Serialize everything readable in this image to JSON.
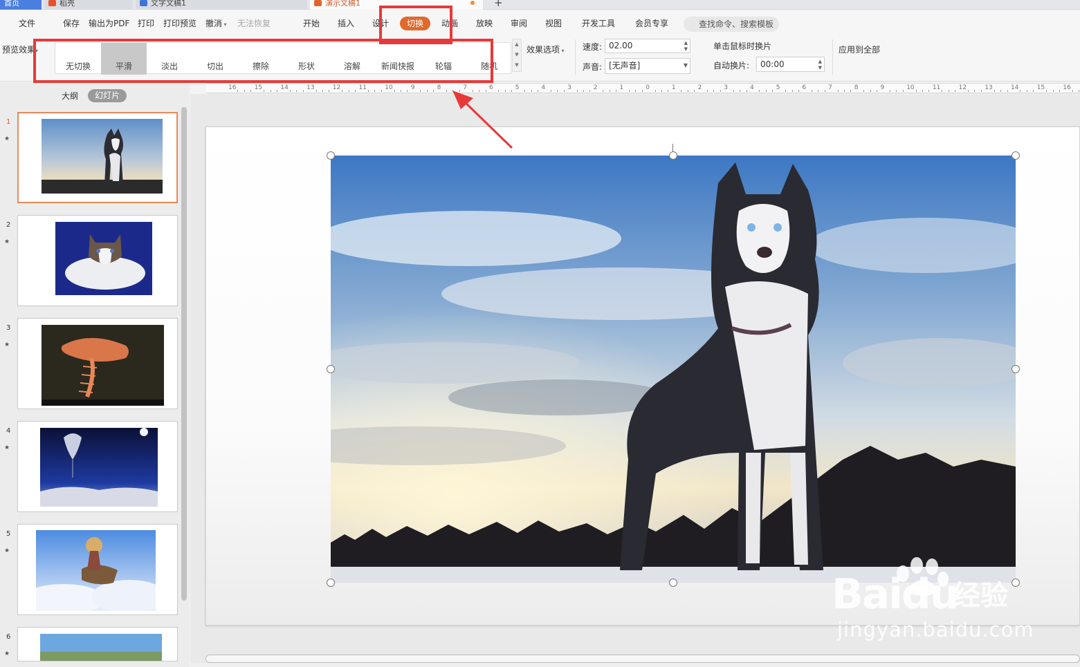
{
  "tabs": {
    "home": "首页",
    "daoke": "稻壳",
    "doc": "文字文稿1",
    "ppt": "演示文稿1",
    "add": "+"
  },
  "menu": {
    "file": "文件",
    "save": "保存",
    "export_pdf": "输出为PDF",
    "print": "打印",
    "print_preview": "打印预览",
    "undo": "撤消",
    "redo": "无法恢复",
    "start": "开始",
    "insert": "插入",
    "design": "设计",
    "transition": "切换",
    "animation": "动画",
    "slideshow": "放映",
    "review": "审阅",
    "view": "视图",
    "devtools": "开发工具",
    "member": "会员专享",
    "search_placeholder": "查找命令、搜索模板"
  },
  "ribbon": {
    "preview_effect": "预览效果",
    "transitions": [
      "无切换",
      "平滑",
      "淡出",
      "切出",
      "擦除",
      "形状",
      "溶解",
      "新闻快报",
      "轮辐",
      "随机"
    ],
    "selected_transition": "平滑",
    "effect_options": "效果选项",
    "speed_label": "速度:",
    "speed_value": "02.00",
    "sound_label": "声音:",
    "sound_value": "[无声音]",
    "on_click": "单击鼠标时换片",
    "auto_label": "自动换片:",
    "auto_value": "00:00",
    "apply_all": "应用到全部"
  },
  "left_panel": {
    "outline": "大纲",
    "slides": "幻灯片",
    "thumbs": [
      {
        "num": "1",
        "subject": "husky"
      },
      {
        "num": "2",
        "subject": "ragdoll-cat"
      },
      {
        "num": "3",
        "subject": "arowana-fish"
      },
      {
        "num": "4",
        "subject": "space-parachute"
      },
      {
        "num": "5",
        "subject": "sky-rider"
      },
      {
        "num": "6",
        "subject": "landscape"
      }
    ],
    "star": "★"
  },
  "ruler": [
    "16",
    "15",
    "14",
    "13",
    "12",
    "11",
    "10",
    "9",
    "8",
    "7",
    "6",
    "5",
    "4",
    "3",
    "2",
    "1",
    "0",
    "1",
    "2",
    "3",
    "4",
    "5",
    "6",
    "7",
    "8",
    "9",
    "10",
    "11",
    "12",
    "13",
    "14",
    "15",
    "16"
  ],
  "watermark": {
    "logo": "Baidu",
    "cn": "经验",
    "url": "jingyan.baidu.com"
  },
  "colors": {
    "accent": "#e06a2c",
    "annotation": "#e8393a"
  }
}
